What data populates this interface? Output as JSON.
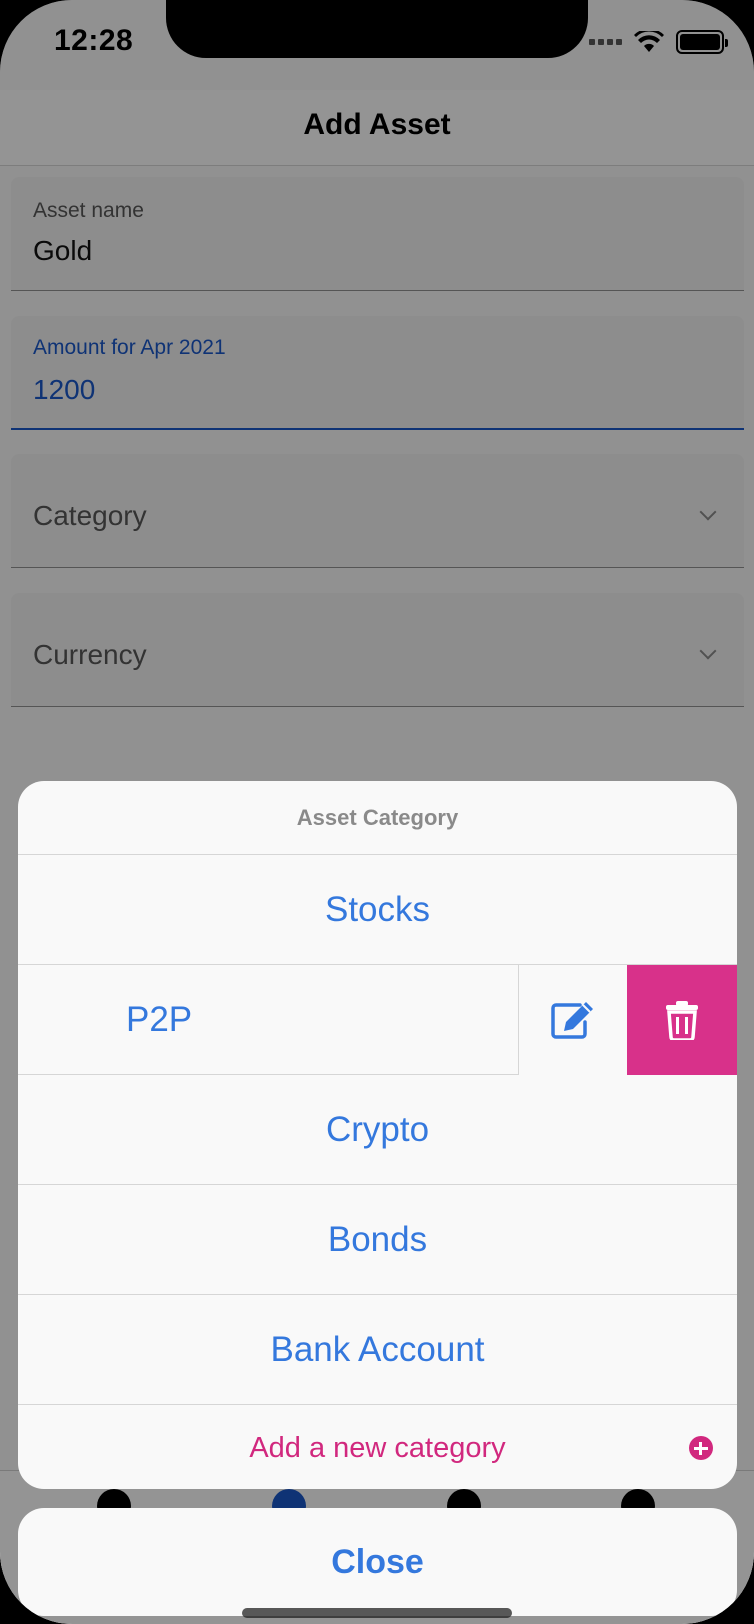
{
  "status_bar": {
    "time": "12:28"
  },
  "nav": {
    "title": "Add Asset"
  },
  "form": {
    "asset_name": {
      "label": "Asset name",
      "value": "Gold"
    },
    "amount": {
      "label": "Amount for Apr 2021",
      "value": "1200"
    },
    "category": {
      "placeholder": "Category"
    },
    "currency": {
      "placeholder": "Currency"
    }
  },
  "sheet": {
    "title": "Asset Category",
    "items": [
      "Stocks",
      "P2P",
      "Crypto",
      "Bonds",
      "Bank Account"
    ],
    "add_label": "Add a new category",
    "close_label": "Close"
  },
  "colors": {
    "accent": "#3478dd",
    "focus": "#1a56c4",
    "destructive": "#d8318a",
    "add": "#d1287e"
  }
}
